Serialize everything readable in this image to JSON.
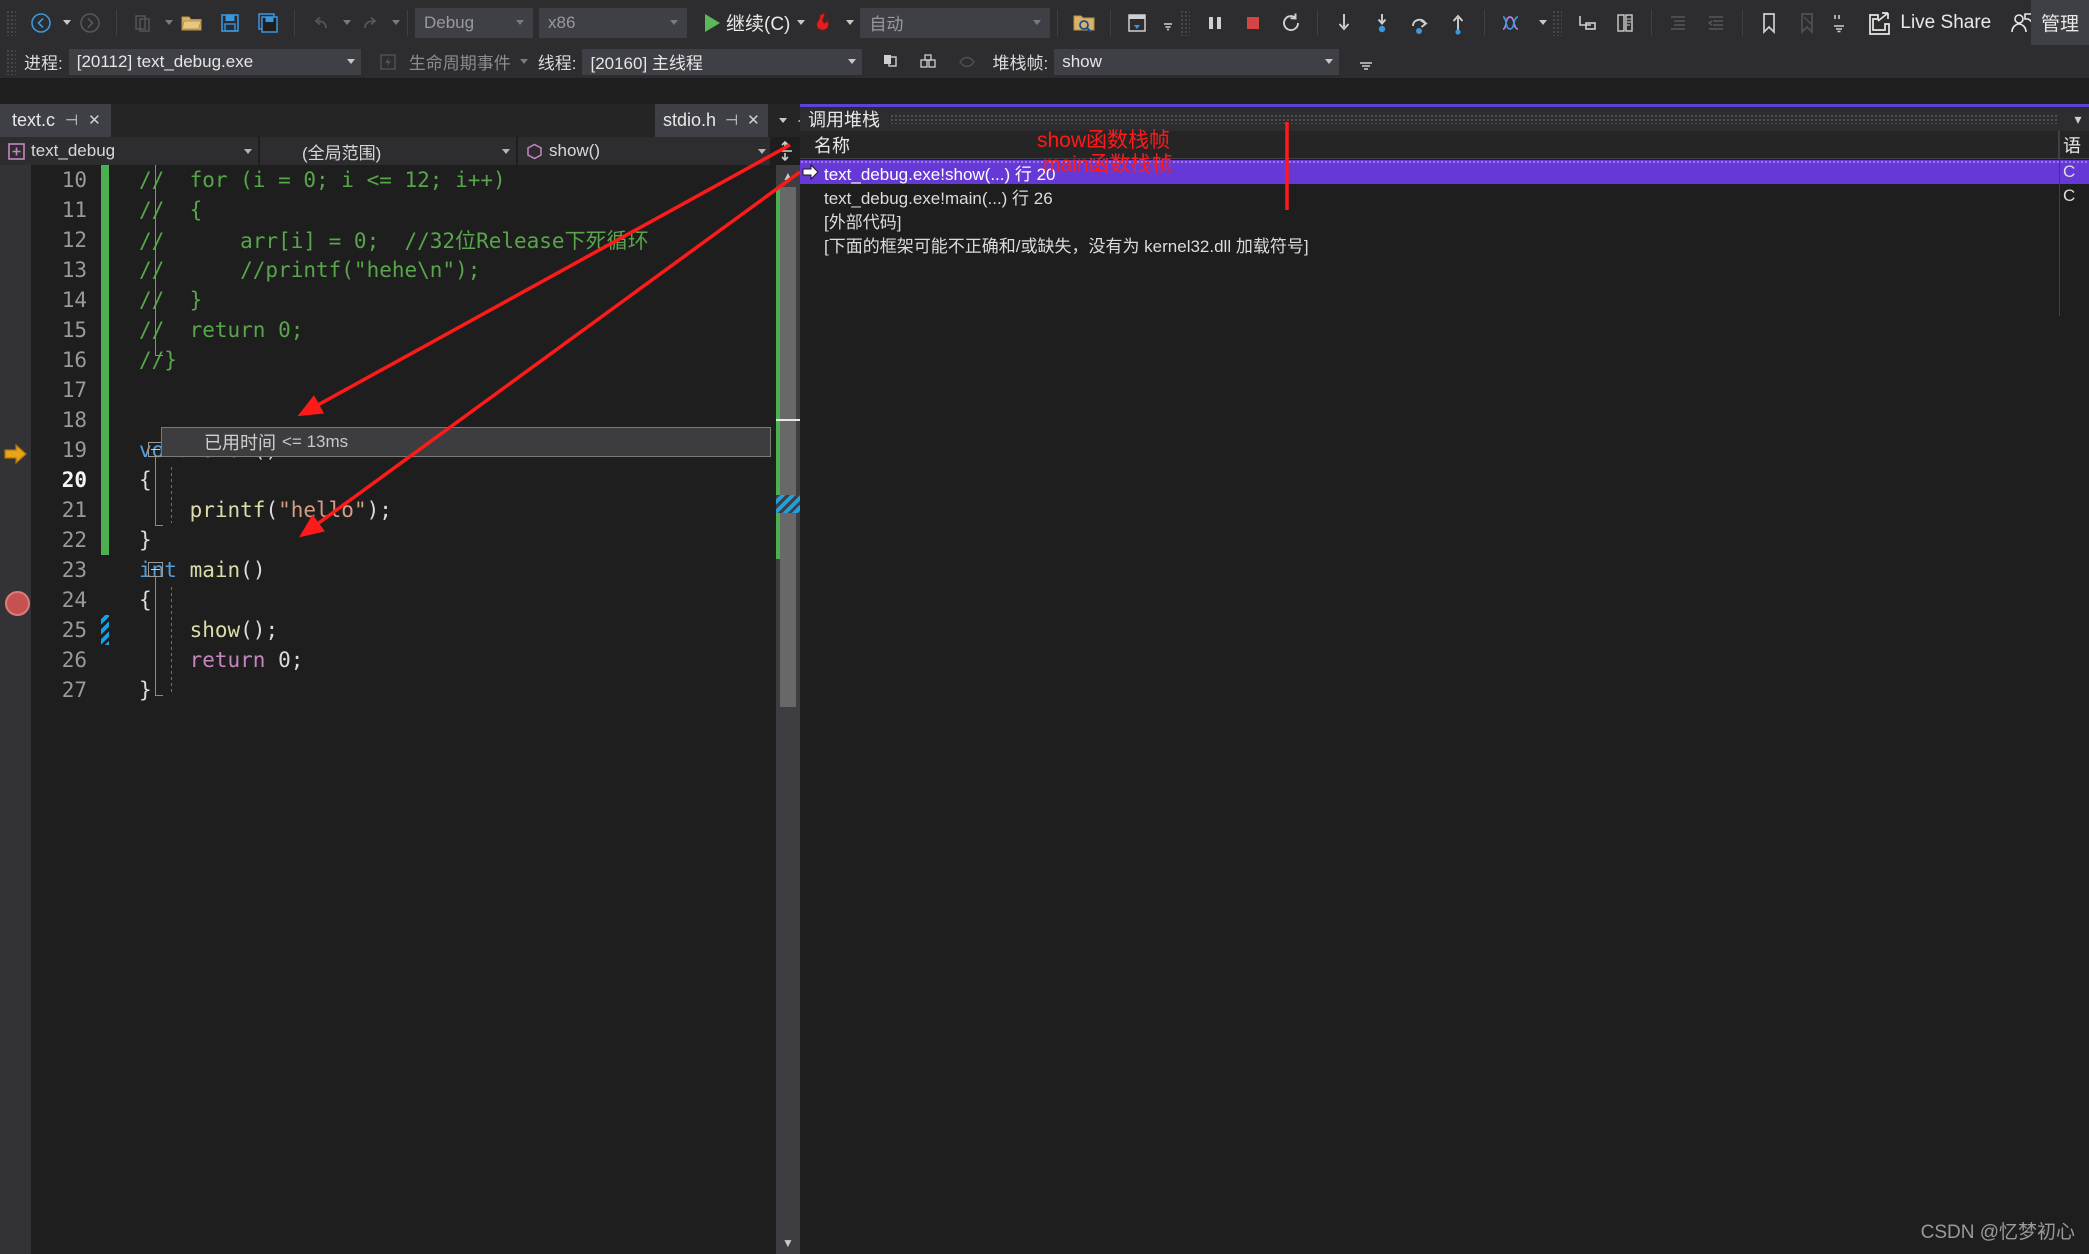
{
  "toolbar": {
    "nav_back_icon": "navigate-back-icon",
    "nav_forward_icon": "navigate-forward-icon",
    "new_item_icon": "new-item-icon",
    "open_file_icon": "open-file-icon",
    "save_icon": "save-icon",
    "save_all_icon": "save-all-icon",
    "undo_icon": "undo-icon",
    "redo_icon": "redo-icon",
    "config_value": "Debug",
    "platform_value": "x86",
    "run_label": "继续(C)",
    "hot_reload_icon": "hot-reload-icon",
    "attach_value": "自动",
    "find_in_files_icon": "find-in-files-icon",
    "window_layout_icon": "window-layout-icon",
    "break_all_icon": "break-all-icon",
    "stop_icon": "stop-debugging-icon",
    "restart_icon": "restart-icon",
    "step_into_icon": "step-into-icon",
    "step_over_icon": "step-over-icon",
    "step_out_icon": "step-out-icon",
    "show_next_statement_icon": "show-next-statement-icon",
    "threads_icon": "threads-window-icon",
    "stack_frame_icon": "stack-frame-icon",
    "compare_icon": "compare-icon",
    "indent_icon": "indent-icon",
    "outdent_icon": "outdent-icon",
    "bookmark_icon": "bookmark-icon",
    "bookmark_prev_icon": "bookmark-prev-icon",
    "comment_icon": "comment-icon",
    "live_share_label": "Live Share",
    "live_share_icon": "live-share-icon",
    "account_icon": "account-icon",
    "admin_label": "管理"
  },
  "debugbar": {
    "process_label": "进程:",
    "process_value": "[20112] text_debug.exe",
    "lifecycle_icon": "lifecycle-events-icon",
    "lifecycle_label": "生命周期事件",
    "thread_label": "线程:",
    "thread_value": "[20160] 主线程",
    "flag_icon": "flag-icon",
    "flag_group_icon": "flag-group-icon",
    "search_thread_icon": "search-thread-icon",
    "stackframe_label": "堆栈帧:",
    "stackframe_value": "show"
  },
  "tabs": {
    "active": "text.c",
    "pin_icon": "pin-icon",
    "close_icon": "close-icon",
    "secondary": "stdio.h",
    "secondary_pin_icon": "pin-icon",
    "secondary_close_icon": "close-icon",
    "overflow_icon": "chevron-down-icon",
    "gear_icon": "gear-icon"
  },
  "navbar": {
    "project": "text_debug",
    "project_icon": "project-icon",
    "scope": "(全局范围)",
    "member": "show()",
    "member_icon": "method-icon",
    "split_icon": "split-window-icon"
  },
  "editor": {
    "datatip_label": "已用时间",
    "datatip_value": "<= 13ms",
    "run_arrow_icon": "current-statement-arrow-icon",
    "breakpoint_icon": "breakpoint-icon",
    "scroll_up_icon": "scroll-up-icon",
    "scroll_down_icon": "scroll-down-icon",
    "lines": [
      {
        "n": "10",
        "change": "green",
        "indent": 0,
        "tokens": [
          {
            "t": "//  for (i = 0; i <= 12; i++)",
            "c": "c-comment"
          }
        ]
      },
      {
        "n": "11",
        "change": "green",
        "indent": 0,
        "tokens": [
          {
            "t": "//  {",
            "c": "c-comment"
          }
        ]
      },
      {
        "n": "12",
        "change": "green",
        "indent": 0,
        "tokens": [
          {
            "t": "//      arr[i] = 0;  //32位Release下死循环",
            "c": "c-comment"
          }
        ]
      },
      {
        "n": "13",
        "change": "green",
        "indent": 0,
        "tokens": [
          {
            "t": "//      //printf(\"hehe\\n\");",
            "c": "c-comment"
          }
        ]
      },
      {
        "n": "14",
        "change": "green",
        "indent": 0,
        "tokens": [
          {
            "t": "//  }",
            "c": "c-comment"
          }
        ]
      },
      {
        "n": "15",
        "change": "green",
        "indent": 0,
        "tokens": [
          {
            "t": "//  return 0;",
            "c": "c-comment"
          }
        ]
      },
      {
        "n": "16",
        "change": "green",
        "indent": 0,
        "tokens": [
          {
            "t": "//}",
            "c": "c-comment"
          }
        ]
      },
      {
        "n": "17",
        "change": "green",
        "indent": 0,
        "tokens": []
      },
      {
        "n": "18",
        "change": "green",
        "indent": 0,
        "tokens": []
      },
      {
        "n": "19",
        "change": "green",
        "indent": 0,
        "tokens": [
          {
            "t": "void",
            "c": "c-key"
          },
          {
            "t": " ",
            "c": "c-plain"
          },
          {
            "t": "show",
            "c": "c-fn"
          },
          {
            "t": "()",
            "c": "c-plain"
          }
        ]
      },
      {
        "n": "20",
        "change": "green",
        "indent": 0,
        "current": true,
        "tokens": [
          {
            "t": "{",
            "c": "c-plain"
          }
        ]
      },
      {
        "n": "21",
        "change": "green",
        "indent": 0,
        "tokens": [
          {
            "t": "    ",
            "c": "c-plain"
          },
          {
            "t": "printf",
            "c": "c-fn"
          },
          {
            "t": "(",
            "c": "c-plain"
          },
          {
            "t": "\"hello\"",
            "c": "c-str"
          },
          {
            "t": ");",
            "c": "c-plain"
          }
        ]
      },
      {
        "n": "22",
        "change": "green",
        "indent": 0,
        "tokens": [
          {
            "t": "}",
            "c": "c-plain"
          }
        ]
      },
      {
        "n": "23",
        "change": "none",
        "indent": 0,
        "tokens": [
          {
            "t": "int",
            "c": "c-key"
          },
          {
            "t": " ",
            "c": "c-plain"
          },
          {
            "t": "main",
            "c": "c-fn"
          },
          {
            "t": "()",
            "c": "c-plain"
          }
        ]
      },
      {
        "n": "24",
        "change": "none",
        "indent": 0,
        "tokens": [
          {
            "t": "{",
            "c": "c-plain"
          }
        ]
      },
      {
        "n": "25",
        "change": "blue",
        "indent": 0,
        "breakpoint": true,
        "tokens": [
          {
            "t": "    ",
            "c": "c-plain"
          },
          {
            "t": "show",
            "c": "c-fn"
          },
          {
            "t": "();",
            "c": "c-plain"
          }
        ]
      },
      {
        "n": "26",
        "change": "none",
        "indent": 0,
        "tokens": [
          {
            "t": "    ",
            "c": "c-plain"
          },
          {
            "t": "return",
            "c": "c-kw2"
          },
          {
            "t": " 0;",
            "c": "c-plain"
          }
        ]
      },
      {
        "n": "27",
        "change": "none",
        "indent": 0,
        "tokens": [
          {
            "t": "}",
            "c": "c-plain"
          }
        ]
      }
    ]
  },
  "callstack": {
    "title": "调用堆栈",
    "columns": [
      "名称",
      "语"
    ],
    "rows": [
      {
        "name": "text_debug.exe!show(...) 行 20",
        "lang": "C",
        "selected": true,
        "current": true
      },
      {
        "name": "text_debug.exe!main(...) 行 26",
        "lang": "C",
        "selected": false,
        "current": false
      },
      {
        "name": "[外部代码]",
        "lang": "",
        "selected": false,
        "current": false
      },
      {
        "name": "[下面的框架可能不正确和/或缺失，没有为 kernel32.dll 加载符号]",
        "lang": "",
        "selected": false,
        "current": false
      }
    ]
  },
  "annotations": {
    "show_frame": "show函数栈帧",
    "main_frame": "main函数栈帧"
  },
  "watermark": "CSDN @忆梦初心",
  "colors": {
    "accent_purple": "#5b43d6",
    "selection": "#6639d6",
    "annotation_red": "#ff1a1a",
    "change_green": "#4caf50",
    "breakpoint_red": "#c75050",
    "run_yellow": "#e8a317"
  }
}
